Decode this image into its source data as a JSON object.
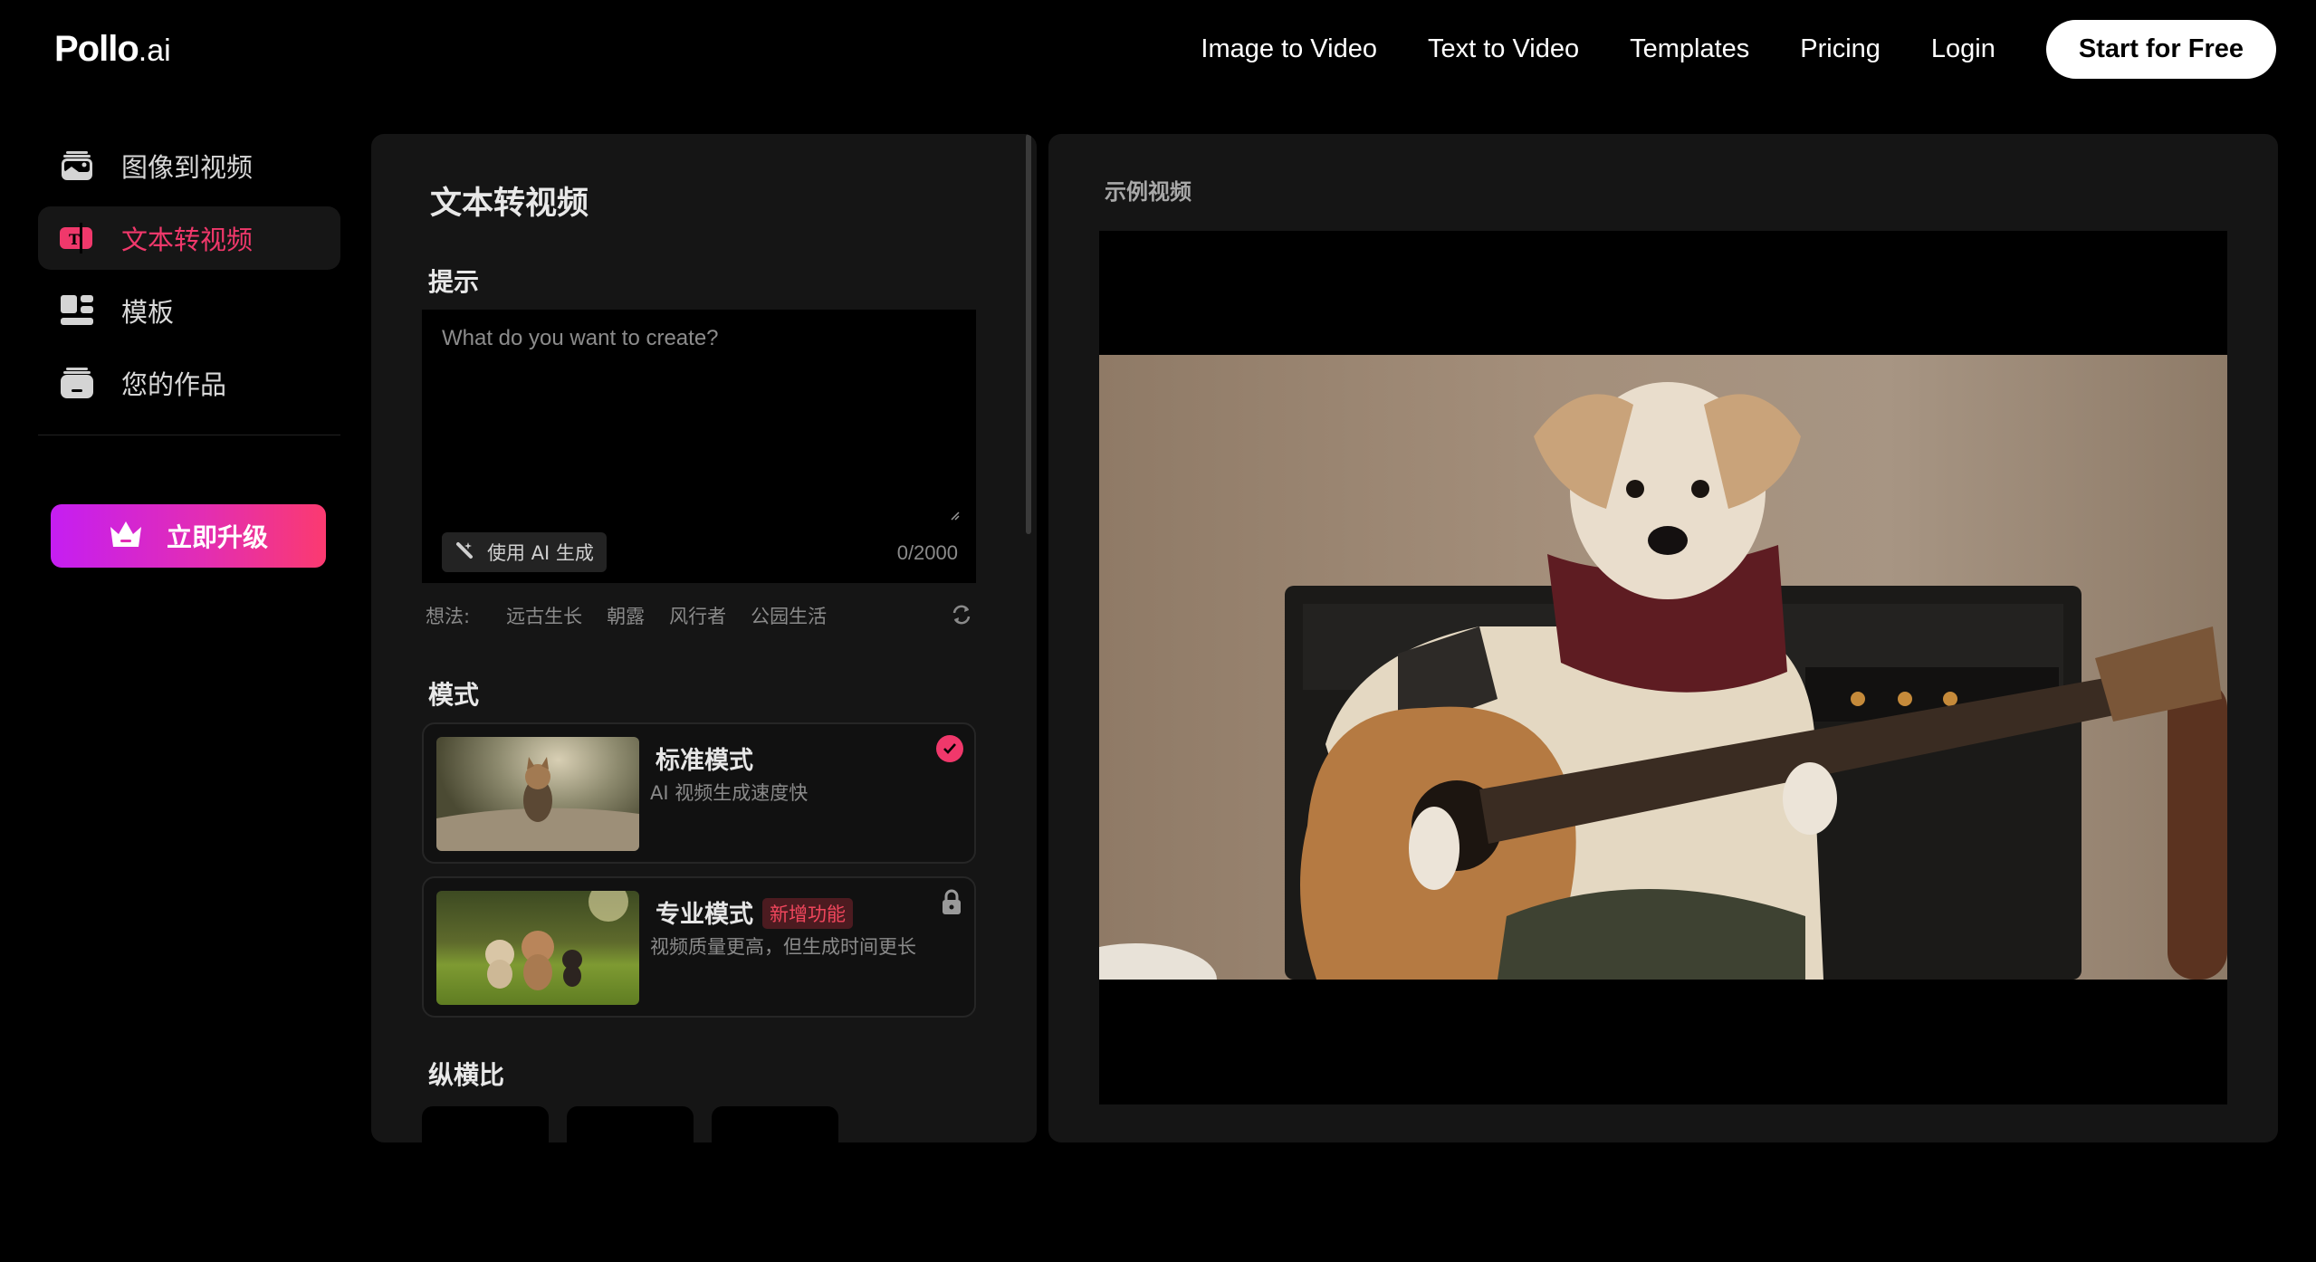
{
  "header": {
    "logo_main": "Pollo",
    "logo_suffix": ".ai",
    "nav": [
      {
        "label": "Image to Video"
      },
      {
        "label": "Text to Video"
      },
      {
        "label": "Templates"
      },
      {
        "label": "Pricing"
      },
      {
        "label": "Login"
      }
    ],
    "cta_label": "Start for Free"
  },
  "sidebar": {
    "items": [
      {
        "label": "图像到视频",
        "icon": "image-stack-icon",
        "active": false
      },
      {
        "label": "文本转视频",
        "icon": "text-video-icon",
        "active": true
      },
      {
        "label": "模板",
        "icon": "template-grid-icon",
        "active": false
      },
      {
        "label": "您的作品",
        "icon": "works-tray-icon",
        "active": false
      }
    ],
    "upgrade_label": "立即升级",
    "upgrade_icon": "crown-icon"
  },
  "left_panel": {
    "title": "文本转视频",
    "prompt": {
      "section_label": "提示",
      "value": "",
      "placeholder": "What do you want to create?",
      "ai_button_label": "使用 AI 生成",
      "counter": "0/2000"
    },
    "ideas": {
      "lead": "想法:",
      "items": [
        "远古生长",
        "朝露",
        "风行者",
        "公园生活"
      ]
    },
    "mode": {
      "section_label": "模式",
      "options": [
        {
          "name": "标准模式",
          "desc": "AI 视频生成速度快",
          "selected": true,
          "locked": false,
          "badge": ""
        },
        {
          "name": "专业模式",
          "desc": "视频质量更高，但生成时间更长",
          "selected": false,
          "locked": true,
          "badge": "新增功能"
        }
      ]
    },
    "aspect_ratio": {
      "section_label": "纵横比"
    }
  },
  "right_panel": {
    "title": "示例视频"
  },
  "colors": {
    "accent": "#f0386b",
    "background": "#000000",
    "panel": "#151515",
    "upgrade_gradient_start": "#c51ef2",
    "upgrade_gradient_end": "#fb3a70"
  }
}
